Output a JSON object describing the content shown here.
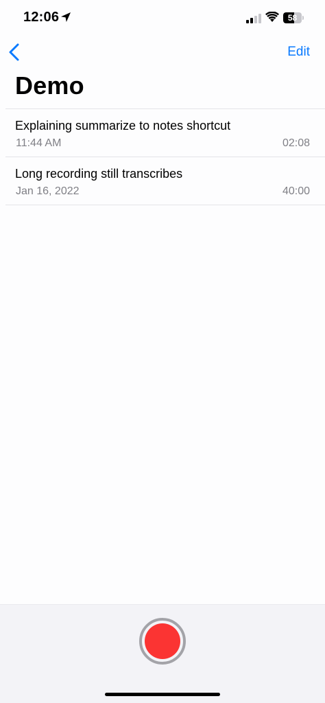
{
  "status_bar": {
    "time": "12:06",
    "battery_level": "58",
    "battery_fraction": 0.58,
    "signal_bars_active": 2,
    "signal_bars_total": 4
  },
  "nav": {
    "back_icon": "chevron-left-icon",
    "edit_label": "Edit",
    "title": "Demo"
  },
  "recordings": [
    {
      "title": "Explaining summarize to notes shortcut",
      "date": "11:44 AM",
      "duration": "02:08"
    },
    {
      "title": "Long recording still transcribes",
      "date": "Jan 16, 2022",
      "duration": "40:00"
    }
  ],
  "toolbar": {
    "record_icon": "record-icon"
  },
  "colors": {
    "accent": "#0a7aff",
    "record": "#fb3433",
    "secondary_text": "#7f7f85",
    "toolbar_bg": "#f3f3f7"
  }
}
